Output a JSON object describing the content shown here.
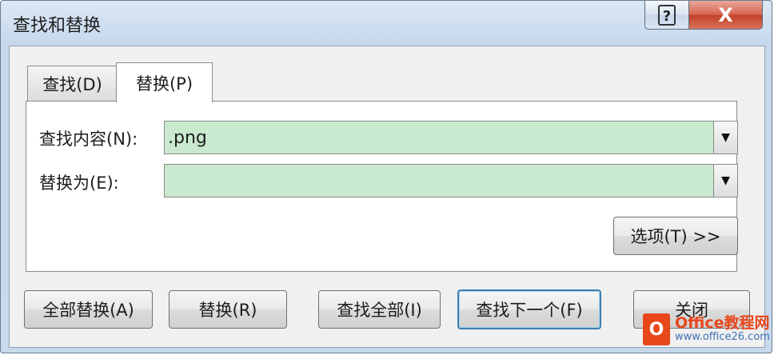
{
  "window": {
    "title": "查找和替换"
  },
  "titlebar": {
    "help_glyph": "?",
    "close_glyph": "X"
  },
  "tabs": [
    {
      "label": "查找(D)",
      "selected": false
    },
    {
      "label": "替换(P)",
      "selected": true
    }
  ],
  "find": {
    "label": "查找内容(N):",
    "value": ".png"
  },
  "replace": {
    "label": "替换为(E):",
    "value": ""
  },
  "options_button": {
    "label": "选项(T) >>"
  },
  "buttons": {
    "replace_all": "全部替换(A)",
    "replace": "替换(R)",
    "find_all": "查找全部(I)",
    "find_next": "查找下一个(F)",
    "close": "关闭"
  },
  "watermark": {
    "brand": "Office教程网",
    "url": "www.office26.com"
  },
  "colors": {
    "input_bg": "#c9e9cf",
    "close_btn": "#c14126",
    "default_btn_border": "#3c7fb1"
  }
}
